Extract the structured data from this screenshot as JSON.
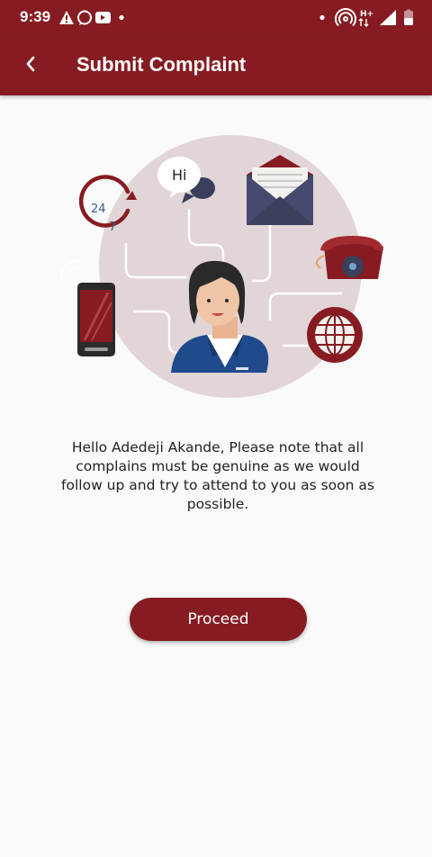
{
  "status_bar": {
    "time": "9:39",
    "left_icons": [
      "warning-icon",
      "whatsapp-icon",
      "youtube-icon",
      "dot-icon"
    ],
    "right_icons": [
      "dot-icon",
      "hotspot-icon",
      "data-hplus-icon",
      "signal-icon",
      "battery-icon"
    ]
  },
  "header": {
    "title": "Submit Complaint",
    "back_icon": "chevron-left-icon"
  },
  "illustration": {
    "speech_text": "Hi",
    "clock_24": "24",
    "clock_7": "7"
  },
  "message": "Hello Adedeji Akande, Please note that all complains must be genuine as we would follow up and try to attend to you as soon as possible.",
  "proceed_button": "Proceed",
  "colors": {
    "primary": "#861c22",
    "background": "#fafafa",
    "circle": "#e2d5d7",
    "navy": "#3a3f5c"
  }
}
